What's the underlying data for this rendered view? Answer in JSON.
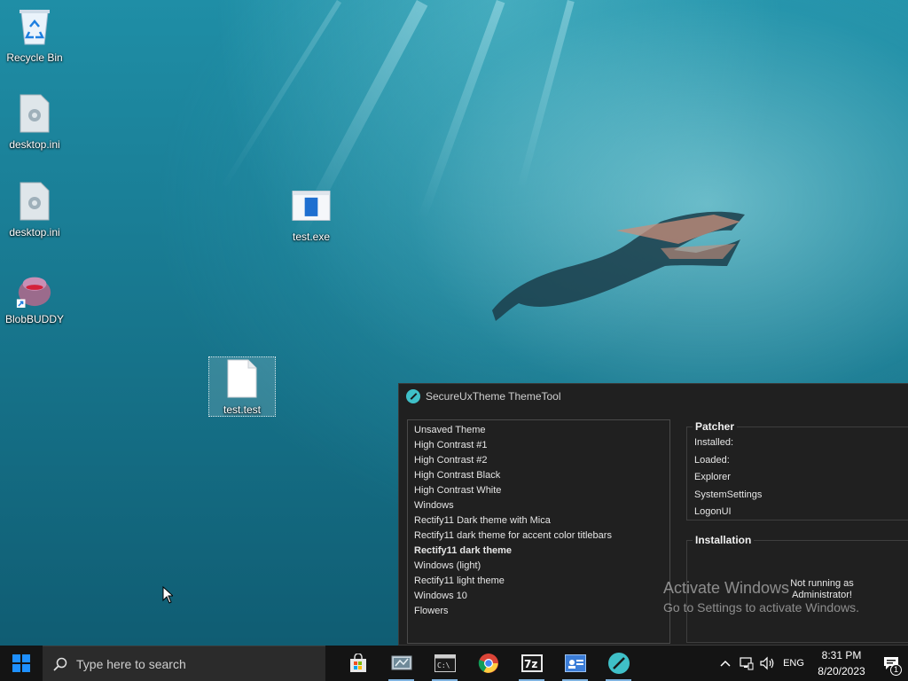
{
  "desktop": {
    "icons": [
      {
        "label": "Recycle Bin",
        "icon": "recycle-bin-icon"
      },
      {
        "label": "desktop.ini",
        "icon": "settings-file-icon"
      },
      {
        "label": "desktop.ini",
        "icon": "settings-file-icon"
      },
      {
        "label": "BlobBUDDY",
        "icon": "blobbuddy-shortcut-icon"
      },
      {
        "label": "test.exe",
        "icon": "exe-file-icon"
      },
      {
        "label": "test.test",
        "icon": "blank-file-icon"
      }
    ]
  },
  "window": {
    "title": "SecureUxTheme ThemeTool",
    "themes": [
      "Unsaved Theme",
      "High Contrast #1",
      "High Contrast #2",
      "High Contrast Black",
      "High Contrast White",
      "Windows",
      "Rectify11 Dark theme with Mica",
      "Rectify11 dark theme for accent color titlebars",
      "Rectify11 dark theme",
      "Windows (light)",
      "Rectify11 light theme",
      "Windows 10",
      "Flowers"
    ],
    "patcher": {
      "title": "Patcher",
      "rows": [
        "Installed:",
        "Loaded:",
        "Explorer",
        "SystemSettings",
        "LogonUI"
      ]
    },
    "installation": {
      "title": "Installation",
      "note": "Not running as Administrator!"
    }
  },
  "watermark": {
    "title": "Activate Windows",
    "subtitle": "Go to Settings to activate Windows."
  },
  "taskbar": {
    "search_placeholder": "Type here to search",
    "apps": [
      "store-icon",
      "control-panel-icon",
      "command-prompt-icon",
      "chrome-icon",
      "7zip-icon",
      "system-info-icon",
      "themetool-icon"
    ],
    "language": "ENG",
    "time": "8:31 PM",
    "date": "8/20/2023",
    "notification_count": "1"
  },
  "colors": {
    "window_bg": "#202020",
    "taskbar_bg": "#141414",
    "accent": "#3fc0c8",
    "windows_blue": "#1e90ff"
  }
}
